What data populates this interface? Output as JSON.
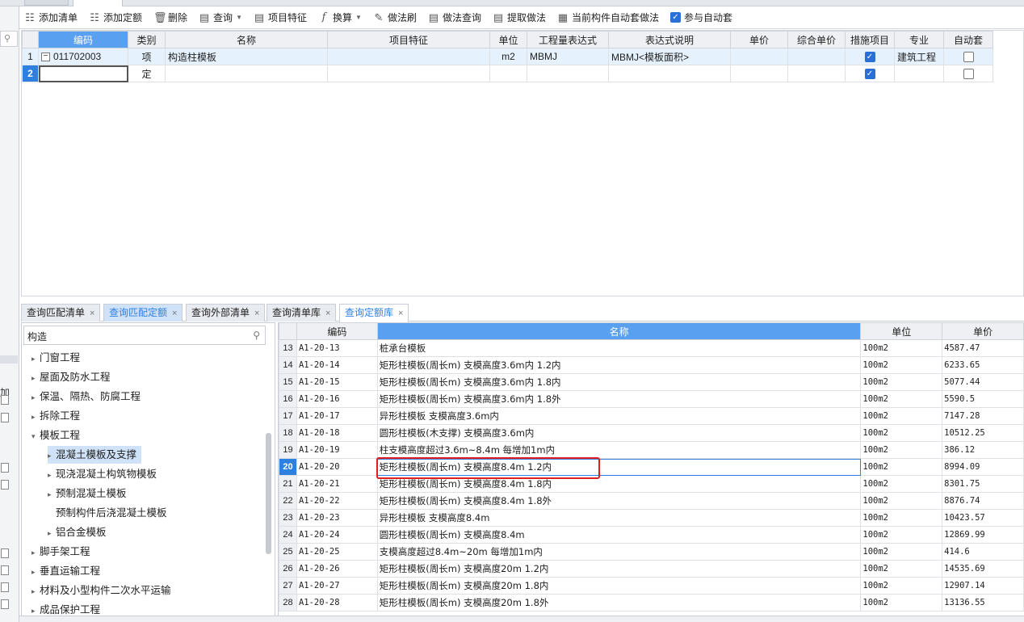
{
  "toolbar": {
    "items": [
      {
        "label": "添加清单",
        "icon": "add-list-icon"
      },
      {
        "label": "添加定额",
        "icon": "add-quota-icon"
      },
      {
        "label": "删除",
        "icon": "trash-icon"
      },
      {
        "label": "查询",
        "icon": "query-icon",
        "dropdown": true
      },
      {
        "label": "项目特征",
        "icon": "feature-icon"
      },
      {
        "label": "换算",
        "icon": "fx-icon",
        "dropdown": true
      },
      {
        "label": "做法刷",
        "icon": "brush-icon"
      },
      {
        "label": "做法查询",
        "icon": "method-query-icon"
      },
      {
        "label": "提取做法",
        "icon": "extract-icon"
      },
      {
        "label": "当前构件自动套做法",
        "icon": "auto-apply-icon"
      }
    ],
    "auto_checkbox_label": "参与自动套"
  },
  "upper_table": {
    "columns": [
      "编码",
      "类别",
      "名称",
      "项目特征",
      "单位",
      "工程量表达式",
      "表达式说明",
      "单价",
      "综合单价",
      "措施项目",
      "专业",
      "自动套"
    ],
    "rows": [
      {
        "num": "1",
        "code": "011702003",
        "type": "项",
        "name": "构造柱模板",
        "feature": "",
        "unit": "m2",
        "expr": "MBMJ",
        "expr_desc": "MBMJ<模板面积>",
        "price": "",
        "comp_price": "",
        "measure": true,
        "major": "建筑工程",
        "auto": false
      },
      {
        "num": "2",
        "code": "",
        "type": "定",
        "name": "",
        "feature": "",
        "unit": "",
        "expr": "",
        "expr_desc": "",
        "price": "",
        "comp_price": "",
        "measure": true,
        "major": "",
        "auto": false
      }
    ]
  },
  "lower_tabs": [
    {
      "label": "查询匹配清单"
    },
    {
      "label": "查询匹配定额"
    },
    {
      "label": "查询外部清单"
    },
    {
      "label": "查询清单库"
    },
    {
      "label": "查询定额库"
    }
  ],
  "tree": {
    "search_value": "构造",
    "items": [
      {
        "label": "门窗工程",
        "level": 0,
        "arrow": "right"
      },
      {
        "label": "屋面及防水工程",
        "level": 0,
        "arrow": "right"
      },
      {
        "label": "保温、隔热、防腐工程",
        "level": 0,
        "arrow": "right"
      },
      {
        "label": "拆除工程",
        "level": 0,
        "arrow": "right"
      },
      {
        "label": "模板工程",
        "level": 0,
        "arrow": "down"
      },
      {
        "label": "混凝土模板及支撑",
        "level": 1,
        "arrow": "right",
        "selected": true
      },
      {
        "label": "现浇混凝土构筑物模板",
        "level": 1,
        "arrow": "right"
      },
      {
        "label": "预制混凝土模板",
        "level": 1,
        "arrow": "right"
      },
      {
        "label": "预制构件后浇混凝土模板",
        "level": 1,
        "arrow": ""
      },
      {
        "label": "铝合金模板",
        "level": 1,
        "arrow": "right"
      },
      {
        "label": "脚手架工程",
        "level": 0,
        "arrow": "right"
      },
      {
        "label": "垂直运输工程",
        "level": 0,
        "arrow": "right"
      },
      {
        "label": "材料及小型构件二次水平运输",
        "level": 0,
        "arrow": "right"
      },
      {
        "label": "成品保护工程",
        "level": 0,
        "arrow": "right"
      }
    ]
  },
  "lower_table": {
    "columns": [
      "编码",
      "名称",
      "单位",
      "单价"
    ],
    "rows": [
      {
        "num": "13",
        "code": "A1-20-13",
        "name": "桩承台模板",
        "unit": "100m2",
        "price": "4587.47"
      },
      {
        "num": "14",
        "code": "A1-20-14",
        "name": "矩形柱模板(周长m) 支模高度3.6m内 1.2内",
        "unit": "100m2",
        "price": "6233.65"
      },
      {
        "num": "15",
        "code": "A1-20-15",
        "name": "矩形柱模板(周长m) 支模高度3.6m内 1.8内",
        "unit": "100m2",
        "price": "5077.44"
      },
      {
        "num": "16",
        "code": "A1-20-16",
        "name": "矩形柱模板(周长m) 支模高度3.6m内 1.8外",
        "unit": "100m2",
        "price": "5590.5"
      },
      {
        "num": "17",
        "code": "A1-20-17",
        "name": "异形柱模板 支模高度3.6m内",
        "unit": "100m2",
        "price": "7147.28"
      },
      {
        "num": "18",
        "code": "A1-20-18",
        "name": "圆形柱模板(木支撑) 支模高度3.6m内",
        "unit": "100m2",
        "price": "10512.25"
      },
      {
        "num": "19",
        "code": "A1-20-19",
        "name": "柱支模高度超过3.6m~8.4m 每增加1m内",
        "unit": "100m2",
        "price": "386.12"
      },
      {
        "num": "20",
        "code": "A1-20-20",
        "name": "矩形柱模板(周长m) 支模高度8.4m 1.2内",
        "unit": "100m2",
        "price": "8994.09",
        "current": true
      },
      {
        "num": "21",
        "code": "A1-20-21",
        "name": "矩形柱模板(周长m) 支模高度8.4m 1.8内",
        "unit": "100m2",
        "price": "8301.75"
      },
      {
        "num": "22",
        "code": "A1-20-22",
        "name": "矩形柱模板(周长m) 支模高度8.4m 1.8外",
        "unit": "100m2",
        "price": "8876.74"
      },
      {
        "num": "23",
        "code": "A1-20-23",
        "name": "异形柱模板 支模高度8.4m",
        "unit": "100m2",
        "price": "10423.57"
      },
      {
        "num": "24",
        "code": "A1-20-24",
        "name": "圆形柱模板(周长m) 支模高度8.4m",
        "unit": "100m2",
        "price": "12869.99"
      },
      {
        "num": "25",
        "code": "A1-20-25",
        "name": "支模高度超过8.4m~20m 每增加1m内",
        "unit": "100m2",
        "price": "414.6"
      },
      {
        "num": "26",
        "code": "A1-20-26",
        "name": "矩形柱模板(周长m) 支模高度20m 1.2内",
        "unit": "100m2",
        "price": "14535.69"
      },
      {
        "num": "27",
        "code": "A1-20-27",
        "name": "矩形柱模板(周长m) 支模高度20m 1.8内",
        "unit": "100m2",
        "price": "12907.14"
      },
      {
        "num": "28",
        "code": "A1-20-28",
        "name": "矩形柱模板(周长m) 支模高度20m 1.8外",
        "unit": "100m2",
        "price": "13136.55"
      }
    ]
  },
  "left_strip": {
    "label": "加"
  },
  "colors": {
    "accent": "#2f7fe0",
    "header_selected": "#5aa0f0",
    "highlight_box": "#e02020"
  }
}
